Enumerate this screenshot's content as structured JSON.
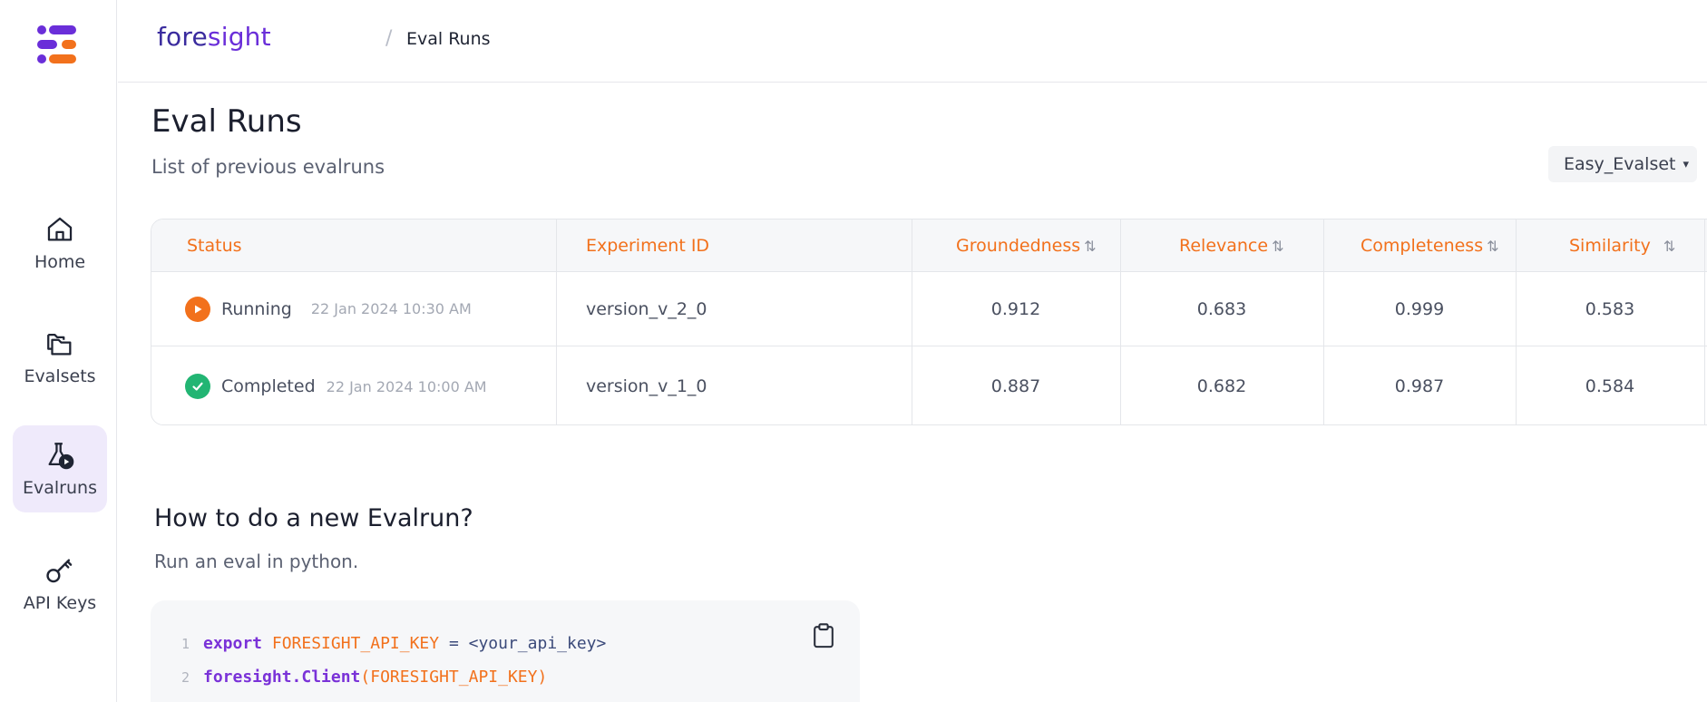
{
  "sidebar": {
    "items": [
      {
        "label": "Home",
        "icon": "home-icon"
      },
      {
        "label": "Evalsets",
        "icon": "folders-icon"
      },
      {
        "label": "Evalruns",
        "icon": "flask-run-icon",
        "active": true
      },
      {
        "label": "API Keys",
        "icon": "key-icon"
      }
    ]
  },
  "header": {
    "brand_part1": "fore",
    "brand_part2": "sight",
    "separator": "/",
    "breadcrumb": "Eval Runs"
  },
  "page": {
    "title": "Eval Runs",
    "subtitle": "List of previous evalruns",
    "evalset_selected": "Easy_Evalset"
  },
  "table": {
    "columns": [
      "Status",
      "Experiment ID",
      "Groundedness",
      "Relevance",
      "Completeness",
      "Similarity"
    ],
    "rows": [
      {
        "status": "Running",
        "time": "22 Jan 2024 10:30 AM",
        "experiment_id": "version_v_2_0",
        "groundedness": "0.912",
        "relevance": "0.683",
        "completeness": "0.999",
        "similarity": "0.583"
      },
      {
        "status": "Completed",
        "time": "22 Jan 2024 10:00 AM",
        "experiment_id": "version_v_1_0",
        "groundedness": "0.887",
        "relevance": "0.682",
        "completeness": "0.987",
        "similarity": "0.584"
      }
    ]
  },
  "howto": {
    "title": "How to do a new Evalrun?",
    "subtitle": "Run an eval in python.",
    "code": {
      "line1_num": "1",
      "line1_kw": "export",
      "line1_const": "FORESIGHT_API_KEY",
      "line1_rest": " = <your_api_key>",
      "line2_num": "2",
      "line2_kw": "foresight.Client",
      "line2_open": "(",
      "line2_const": "FORESIGHT_API_KEY",
      "line2_close": ")"
    }
  },
  "colors": {
    "accent_orange": "#f2711c",
    "accent_purple": "#6a2ed9",
    "success_green": "#22b573",
    "active_nav_bg": "#efeafb"
  }
}
